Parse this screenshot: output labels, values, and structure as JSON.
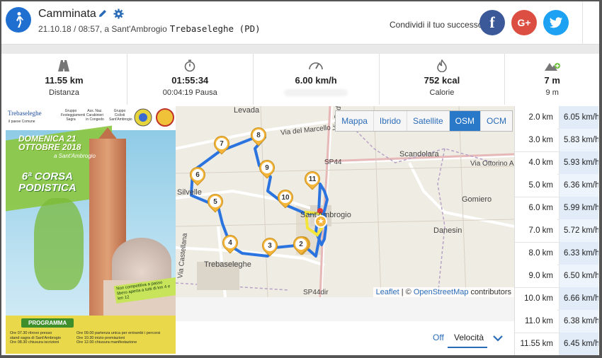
{
  "activity": {
    "title": "Camminata",
    "date_time": "21.10.18 / 08:57, a Sant'Ambrogio",
    "town": "Trebaseleghe (PD)",
    "icon": "walking-person-icon",
    "edit_icon": "pencil-icon",
    "settings_icon": "gear-icon"
  },
  "share": {
    "label": "Condividi il tuo successo",
    "facebook": "f",
    "google": "G+",
    "colors": {
      "facebook": "#3b5998",
      "google": "#dc4e41",
      "twitter": "#1da1f2"
    }
  },
  "stats": [
    {
      "icon": "road-icon",
      "value": "11.55 km",
      "label": "Distanza"
    },
    {
      "icon": "stopwatch-icon",
      "value": "01:55:34",
      "label": "00:04:19 Pausa"
    },
    {
      "icon": "speedometer-icon",
      "value": "6.00 km/h",
      "label": ""
    },
    {
      "icon": "flame-icon",
      "value": "752 kcal",
      "label": "Calorie"
    },
    {
      "icon": "mountain-up-icon",
      "value": "7 m",
      "label": "9 m"
    }
  ],
  "poster": {
    "logo_main": "Trebaseleghe",
    "logo_main_sub": "il paese Comune",
    "org1": "Gruppo Festeggiamenti Sagra",
    "org2": "Ass. Naz. Carabinieri in Congedo",
    "org3": "Gruppo Ciclisti Sant'Ambrogio",
    "day": "DOMENICA",
    "day_num": "21",
    "month_year": "OTTOBRE 2018",
    "place": "a Sant'Ambrogio",
    "edition": "6ª CORSA",
    "event": "PODISTICA",
    "note": "Non competitiva a passo libero aperta a tutti di km 4 e km 12",
    "programma": "PROGRAMMA",
    "schedule_left": [
      "Ore 07.30 ritrovo presso",
      "stand sagra di Sant'Ambrogio",
      "Ore 08.30 chiusura iscrizioni"
    ],
    "schedule_right": [
      "Ore 09.00 partenza unica per entrambi i percorsi",
      "Ore 10.30 inizio premiazioni",
      "Ore 12.00 chiusura manifestazione"
    ]
  },
  "map": {
    "tabs": [
      "Mappa",
      "Ibrido",
      "Satellite",
      "OSM",
      "OCM"
    ],
    "active_tab": "OSM",
    "labels": {
      "levada": "Levada",
      "marcello": "Via del Marcello",
      "padova": "Via Padova",
      "scandolara": "Scandolara",
      "alessi": "Via Ottorino Alessi",
      "sp44": "SP44",
      "gomiero": "Gomiero",
      "santambrogio": "Sant'Ambrogio",
      "danesin": "Danesin",
      "silvelle": "Silvelle",
      "castellana": "Via Castellana",
      "trebaseleghe": "Trebaseleghe",
      "sp44dir": "SP44dir"
    },
    "markers": [
      "1",
      "2",
      "3",
      "4",
      "5",
      "6",
      "7",
      "8",
      "9",
      "10",
      "11"
    ],
    "attribution": {
      "leaflet": "Leaflet",
      "sep": " | © ",
      "osm": "OpenStreetMap",
      "rest": " contributors"
    },
    "route_color": "#2b74e0"
  },
  "speed_toggle": {
    "off": "Off",
    "selected": "Velocità",
    "chevron": "chevron-down-icon"
  },
  "splits": [
    {
      "distance": "2.0 km",
      "speed": "6.05 km/h"
    },
    {
      "distance": "3.0 km",
      "speed": "5.83 km/h"
    },
    {
      "distance": "4.0 km",
      "speed": "5.93 km/h"
    },
    {
      "distance": "5.0 km",
      "speed": "6.36 km/h"
    },
    {
      "distance": "6.0 km",
      "speed": "5.99 km/h"
    },
    {
      "distance": "7.0 km",
      "speed": "5.72 km/h"
    },
    {
      "distance": "8.0 km",
      "speed": "6.33 km/h"
    },
    {
      "distance": "9.0 km",
      "speed": "6.50 km/h"
    },
    {
      "distance": "10.0 km",
      "speed": "6.66 km/h"
    },
    {
      "distance": "11.0 km",
      "speed": "6.38 km/h"
    },
    {
      "distance": "11.55 km",
      "speed": "6.45 km/h"
    }
  ]
}
